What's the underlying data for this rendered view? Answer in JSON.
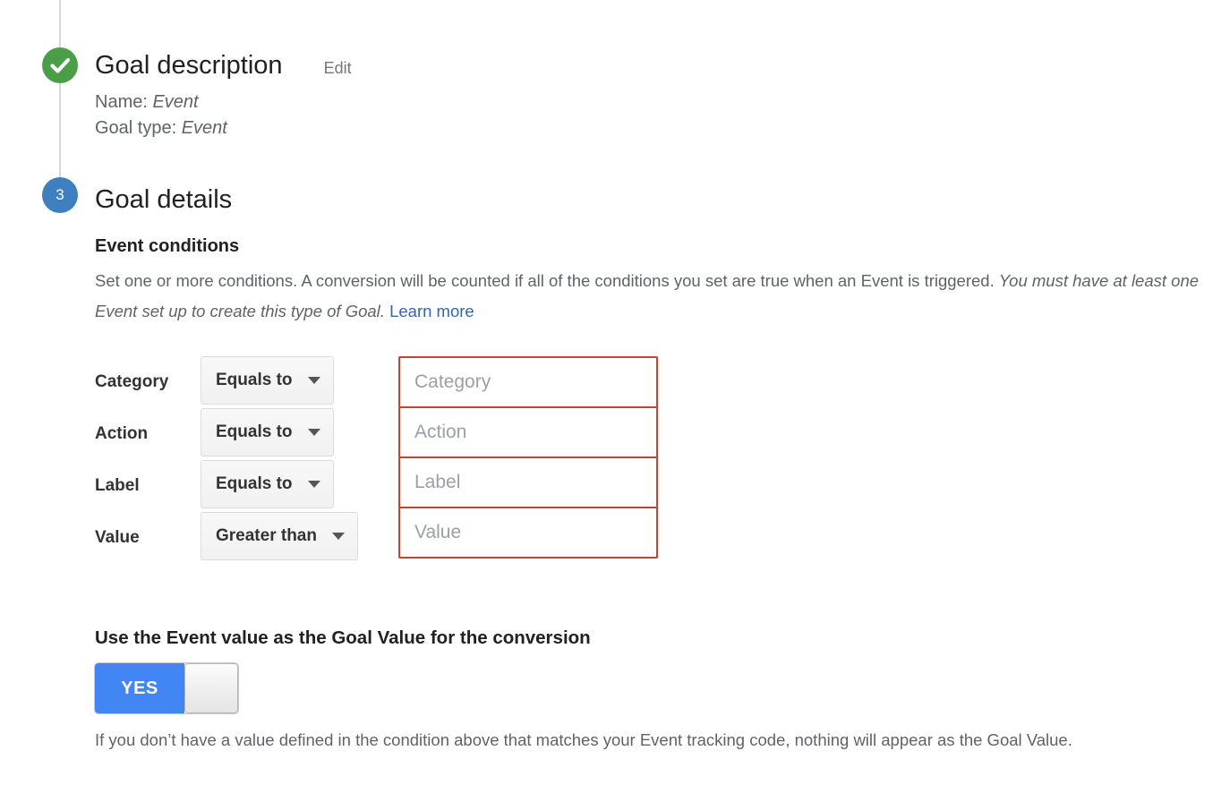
{
  "stepper": {
    "completed_icon": "check-circle-icon",
    "current_step_number": "3"
  },
  "goal_description": {
    "title": "Goal description",
    "edit_label": "Edit",
    "name_line": "Name: ",
    "name_value": "Event",
    "type_line": "Goal type: ",
    "type_value": "Event"
  },
  "goal_details": {
    "title": "Goal details",
    "subhead": "Event conditions",
    "helper_plain": "Set one or more conditions. A conversion will be counted if all of the conditions you set are true when an Event is triggered. ",
    "helper_italic": "You must have at least one Event set up to create this type of Goal.",
    "helper_link": "Learn more"
  },
  "conditions": {
    "rows": [
      {
        "label": "Category",
        "operator": "Equals to",
        "placeholder": "Category",
        "value": ""
      },
      {
        "label": "Action",
        "operator": "Equals to",
        "placeholder": "Action",
        "value": ""
      },
      {
        "label": "Label",
        "operator": "Equals to",
        "placeholder": "Label",
        "value": ""
      },
      {
        "label": "Value",
        "operator": "Greater than",
        "placeholder": "Value",
        "value": ""
      }
    ],
    "caret_icon": "chevron-down-icon",
    "input_border_color": "#c4452e"
  },
  "event_value": {
    "heading": "Use the Event value as the Goal Value for the conversion",
    "toggle_on_label": "YES",
    "toggle_state": "on",
    "toggle_on_color": "#4285f4",
    "note": "If you don’t have a value defined in the condition above that matches your Event tracking code, nothing will appear as the Goal Value."
  },
  "colors": {
    "step_done": "#4a9e47",
    "step_current": "#3d7fbf",
    "link": "#3366aa"
  }
}
